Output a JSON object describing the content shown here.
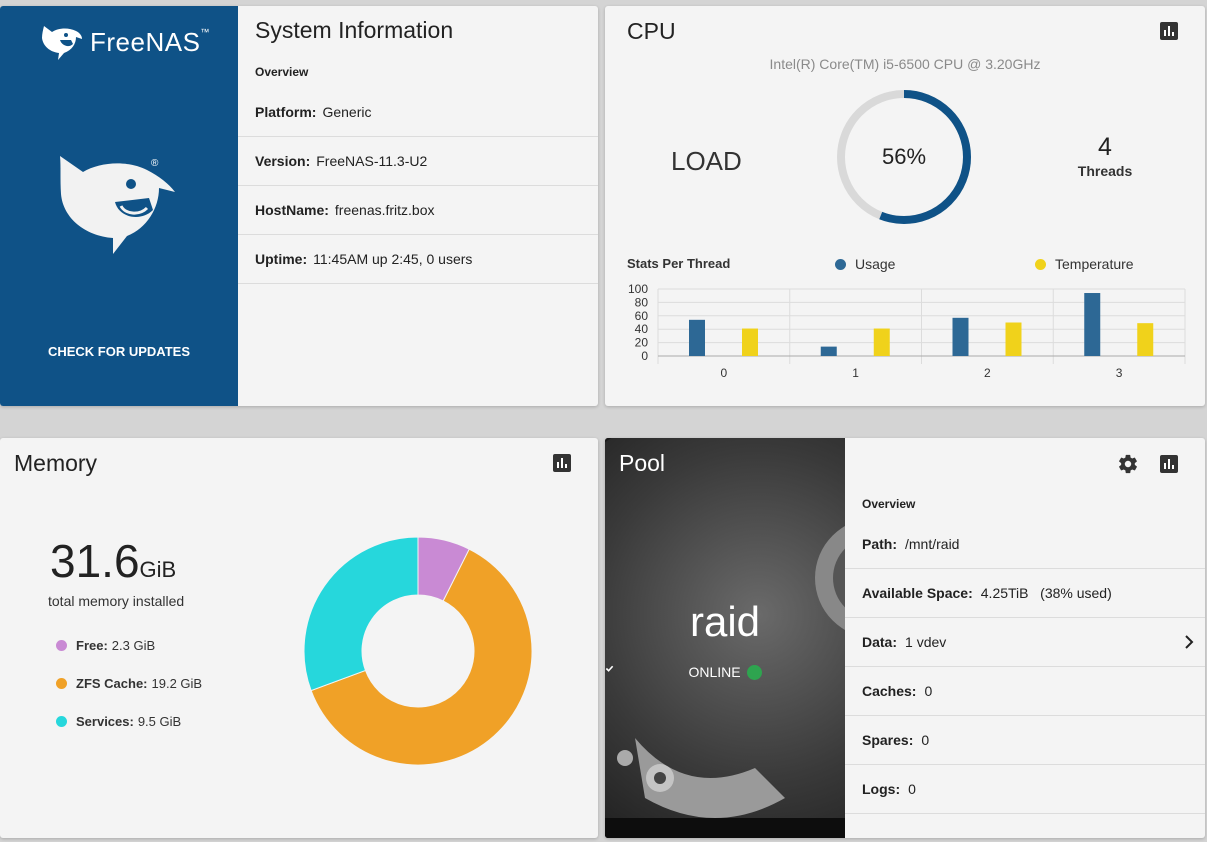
{
  "system": {
    "brand": "FreeNAS",
    "check_updates": "CHECK FOR UPDATES",
    "title": "System Information",
    "overview": "Overview",
    "rows": [
      {
        "key": "Platform:",
        "value": "Generic"
      },
      {
        "key": "Version:",
        "value": "FreeNAS-11.3-U2"
      },
      {
        "key": "HostName:",
        "value": "freenas.fritz.box"
      },
      {
        "key": "Uptime:",
        "value": "11:45AM up 2:45, 0 users"
      }
    ],
    "brand_color": "#0f5287"
  },
  "cpu": {
    "title": "CPU",
    "model": "Intel(R) Core(TM) i5-6500 CPU @ 3.20GHz",
    "load_label": "LOAD",
    "load_value": 56,
    "load_text": "56%",
    "threads_value": "4",
    "threads_label": "Threads",
    "stats_title": "Stats Per Thread",
    "legend_usage": "Usage",
    "legend_temperature": "Temperature",
    "usage_color": "#2d6895",
    "temperature_color": "#f0d21b",
    "ring_color": "#0f5287",
    "ring_track_color": "#d9d9d9"
  },
  "chart_data": {
    "type": "bar",
    "title": "Stats Per Thread",
    "categories": [
      "0",
      "1",
      "2",
      "3"
    ],
    "series": [
      {
        "name": "Usage",
        "values": [
          54,
          14,
          57,
          94
        ]
      },
      {
        "name": "Temperature",
        "values": [
          41,
          41,
          50,
          49
        ]
      }
    ],
    "ylim": [
      0,
      100
    ],
    "yticks": [
      "100",
      "80",
      "60",
      "40",
      "20",
      "0"
    ],
    "grid": true,
    "legend": "top"
  },
  "memory": {
    "title": "Memory",
    "total_value": "31.6",
    "total_unit": "GiB",
    "caption": "total memory installed",
    "items": [
      {
        "label": "Free:",
        "value": "2.3 GiB",
        "amount": 2.3,
        "color": "#c98ad4"
      },
      {
        "label": "ZFS Cache:",
        "value": "19.2 GiB",
        "amount": 19.2,
        "color": "#f0a127"
      },
      {
        "label": "Services:",
        "value": "9.5 GiB",
        "amount": 9.5,
        "color": "#26d7dc"
      }
    ]
  },
  "pool": {
    "title": "Pool",
    "name": "raid",
    "status": "ONLINE",
    "overview": "Overview",
    "rows": [
      {
        "key": "Path:",
        "value": "/mnt/raid"
      },
      {
        "key": "Available Space:",
        "value": "4.25TiB   (38% used)"
      },
      {
        "key": "Data:",
        "value": "1 vdev"
      },
      {
        "key": "Caches:",
        "value": "0"
      },
      {
        "key": "Spares:",
        "value": "0"
      },
      {
        "key": "Logs:",
        "value": "0"
      }
    ]
  }
}
